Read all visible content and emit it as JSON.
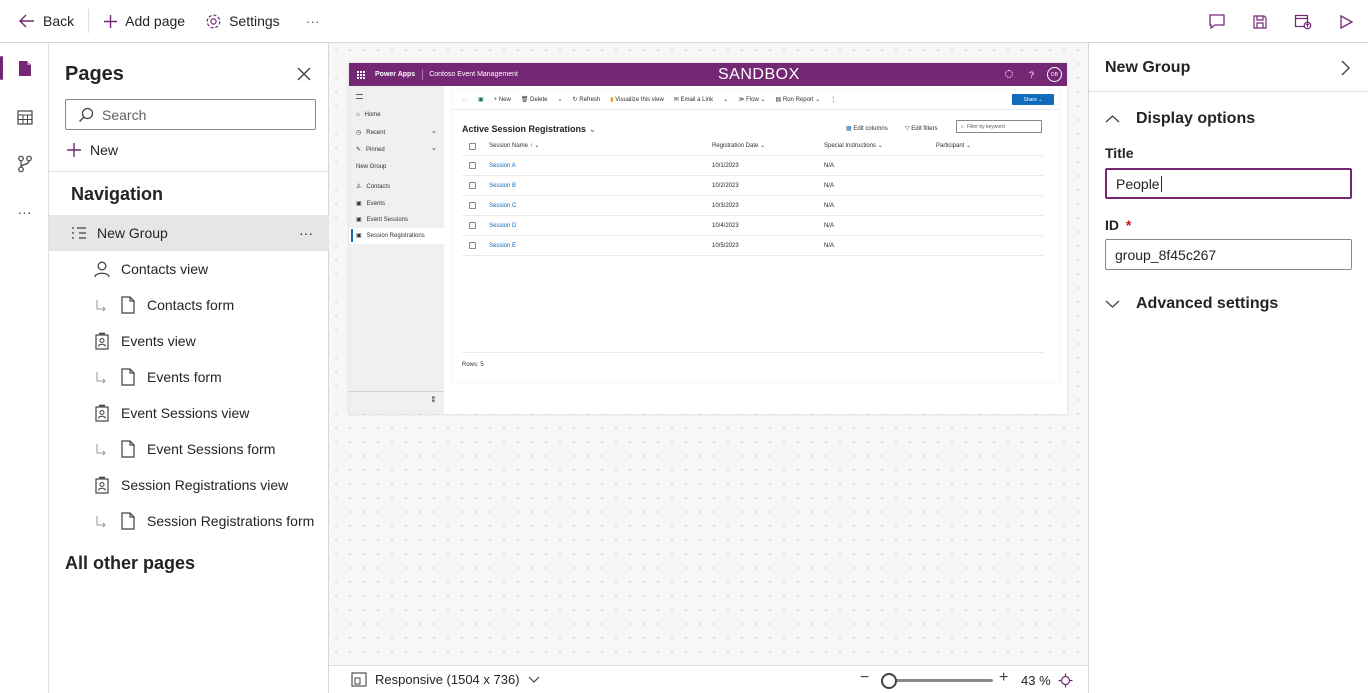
{
  "topbar": {
    "back_label": "Back",
    "add_page_label": "Add page",
    "settings_label": "Settings",
    "more_label": "···"
  },
  "pages_panel": {
    "title": "Pages",
    "search_placeholder": "Search",
    "new_label": "New",
    "navigation_title": "Navigation",
    "group_label": "New Group",
    "group_more": "···",
    "items": [
      {
        "label": "Contacts view",
        "icon": "person-icon"
      },
      {
        "label": "Contacts form",
        "icon": "form-icon"
      },
      {
        "label": "Events view",
        "icon": "entity-view-icon"
      },
      {
        "label": "Events form",
        "icon": "form-icon"
      },
      {
        "label": "Event Sessions view",
        "icon": "entity-view-icon"
      },
      {
        "label": "Event Sessions form",
        "icon": "form-icon"
      },
      {
        "label": "Session Registrations view",
        "icon": "entity-view-icon"
      },
      {
        "label": "Session Registrations form",
        "icon": "form-icon"
      }
    ],
    "other_title": "All other pages"
  },
  "preview": {
    "app_name": "Power Apps",
    "app_title": "Contoso Event Management",
    "banner": "SANDBOX",
    "user_initials": "DB",
    "sitemap": {
      "home": "Home",
      "recent": "Recent",
      "pinned": "Pinned",
      "group": "New Group",
      "items": [
        "Contacts",
        "Events",
        "Event Sessions",
        "Session Registrations"
      ]
    },
    "commands": {
      "new": "New",
      "delete": "Delete",
      "refresh": "Refresh",
      "visualize": "Visualize this view",
      "email": "Email a Link",
      "flow": "Flow",
      "run_report": "Run Report",
      "share": "Share"
    },
    "view_title": "Active Session Registrations",
    "edit_columns": "Edit columns",
    "edit_filters": "Edit filters",
    "filter_placeholder": "Filter by keyword",
    "columns": [
      "Session Name ↑",
      "Registration Date",
      "Special Instructions",
      "Participant"
    ],
    "rows": [
      {
        "name": "Session A",
        "date": "10/1/2023",
        "instr": "N/A"
      },
      {
        "name": "Session B",
        "date": "10/2/2023",
        "instr": "N/A"
      },
      {
        "name": "Session C",
        "date": "10/3/2023",
        "instr": "N/A"
      },
      {
        "name": "Session D",
        "date": "10/4/2023",
        "instr": "N/A"
      },
      {
        "name": "Session E",
        "date": "10/5/2023",
        "instr": "N/A"
      }
    ],
    "rows_count": "Rows: 5"
  },
  "bottombar": {
    "responsive_label": "Responsive (1504 x 736)",
    "zoom_label": "43 %",
    "zoom_value": 0.43
  },
  "props": {
    "title": "New Group",
    "display_options": "Display options",
    "title_label": "Title",
    "title_value": "People",
    "id_label": "ID",
    "required_mark": "*",
    "id_value": "group_8f45c267",
    "advanced": "Advanced settings"
  },
  "colors": {
    "accent": "#742774",
    "link": "#0f6cbd",
    "share_button": "#0f6cbd"
  }
}
